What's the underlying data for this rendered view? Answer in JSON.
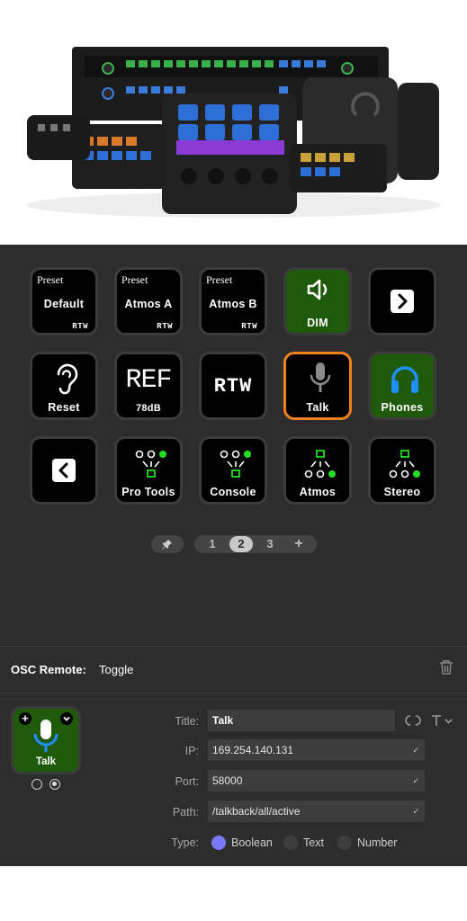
{
  "deck": {
    "keys": {
      "default": {
        "preset": "Preset",
        "label": "Default",
        "brand": "RTW"
      },
      "atmos_a": {
        "preset": "Preset",
        "label": "Atmos A",
        "brand": "RTW"
      },
      "atmos_b": {
        "preset": "Preset",
        "label": "Atmos B",
        "brand": "RTW"
      },
      "dim": {
        "label": "DIM"
      },
      "reset": {
        "label": "Reset"
      },
      "ref": {
        "title": "REF",
        "label": "78dB"
      },
      "rtw_logo": {
        "label": "RTW"
      },
      "talk": {
        "label": "Talk"
      },
      "phones": {
        "label": "Phones"
      },
      "pro_tools": {
        "label": "Pro Tools"
      },
      "console": {
        "label": "Console"
      },
      "atmos": {
        "label": "Atmos"
      },
      "stereo": {
        "label": "Stereo"
      }
    },
    "pages": [
      "1",
      "2",
      "3",
      "+"
    ],
    "active_page": "2"
  },
  "inspector": {
    "title": "OSC Remote:",
    "action": "Toggle",
    "preview_label": "Talk",
    "title_label": "Title:",
    "title_value": "Talk",
    "ip_label": "IP:",
    "ip_value": "169.254.140.131",
    "port_label": "Port:",
    "port_value": "58000",
    "path_label": "Path:",
    "path_value": "/talkback/all/active",
    "type_label": "Type:",
    "types": [
      "Boolean",
      "Text",
      "Number"
    ],
    "selected_type": "Boolean"
  },
  "colors": {
    "panel": "#2d2d2d",
    "key_green": "#1e5a0a",
    "selection": "#f0821e",
    "accent_radio": "#7a78f8",
    "indicator_green": "#22dd22",
    "headphone_blue": "#1e90ff"
  }
}
